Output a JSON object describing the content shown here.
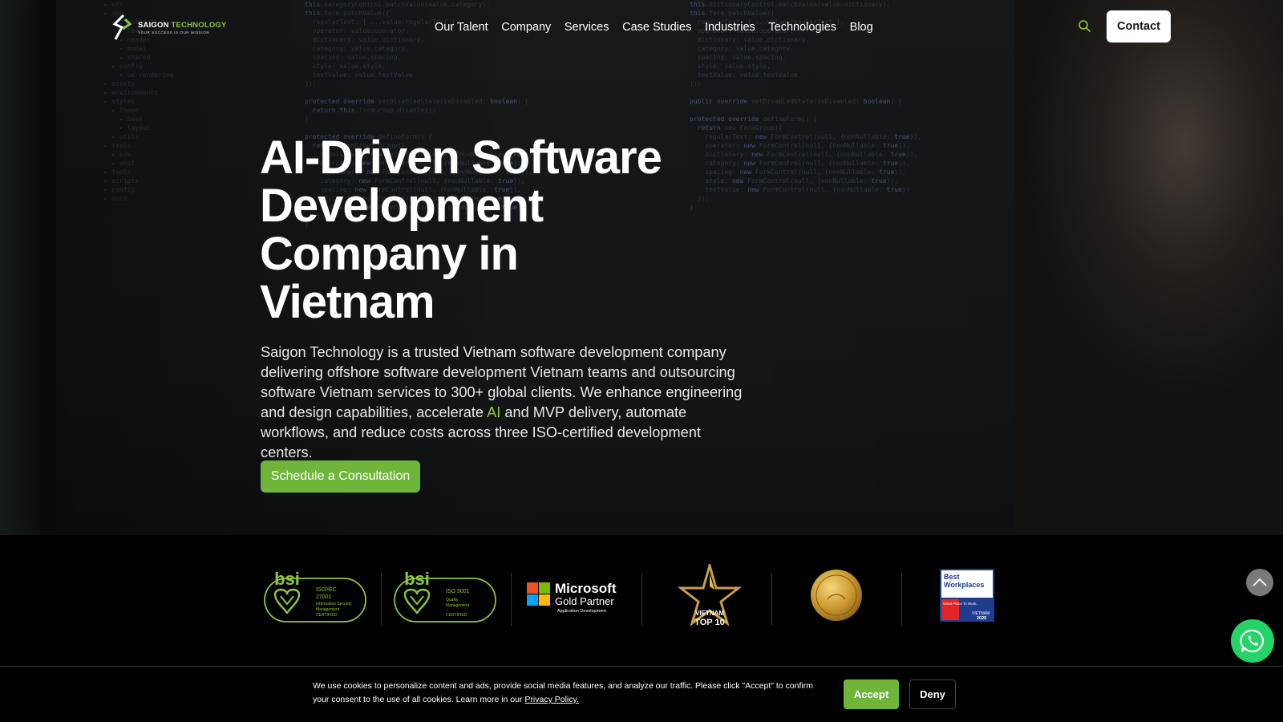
{
  "logo": {
    "name_part1": "SAIGON ",
    "name_part2": "TECHNOLOGY",
    "tagline": "YOUR SUCCESS IS OUR MISSION"
  },
  "nav": {
    "items": [
      {
        "label": "Our Talent"
      },
      {
        "label": "Company"
      },
      {
        "label": "Services"
      },
      {
        "label": "Case Studies"
      },
      {
        "label": "Industries"
      },
      {
        "label": "Technologies"
      },
      {
        "label": "Blog"
      }
    ],
    "search_icon": "search-icon",
    "contact_label": "Contact"
  },
  "hero": {
    "title": "AI-Driven Software Development Company in Vietnam",
    "desc_before": "Saigon Technology is a trusted Vietnam software development company delivering offshore software development Vietnam teams and outsourcing software Vietnam services to 300+ global clients. We enhance engineering and design capabilities, accelerate ",
    "desc_ai": "AI",
    "desc_after": " and MVP delivery, automate workflows, and reduce costs across three ISO-certified development centers.",
    "cta_label": "Schedule a Consultation"
  },
  "badges": {
    "iso27001": {
      "brand": "bsi",
      "l1": "ISO/IEC",
      "l2": "27001",
      "l3": "Information Security",
      "l4": "Management",
      "l5": "CERTIFIED"
    },
    "iso9001": {
      "brand": "bsi",
      "l1": "ISO 9001",
      "l2": "Quality",
      "l3": "Management",
      "l4": "CERTIFIED"
    },
    "microsoft": {
      "name": "Microsoft",
      "partner": "Gold Partner",
      "sub": "Application Development"
    },
    "top10": {
      "l1": "VIETNAM",
      "l2": "TOP 10"
    },
    "medal": "medal-icon",
    "best_workplaces": {
      "l1": "Best",
      "l2": "Workplaces",
      "great": "Great Place To Work.",
      "country": "VIETNAM",
      "year": "2025"
    }
  },
  "floating": {
    "scroll_top_icon": "chevron-up-icon",
    "whatsapp_icon": "whatsapp-icon"
  },
  "cookie": {
    "text": "We use cookies to personalize content and ads, provide social media features, and analyze our traffic. Please click \"Accept\" to confirm your consent to the use of all cookies. Learn more in our ",
    "link": "Privacy Policy.",
    "accept": "Accept",
    "deny": "Deny"
  },
  "colors": {
    "brand_green": "#6fb53a",
    "accent_green": "#8cc63f",
    "whatsapp": "#25d366"
  }
}
